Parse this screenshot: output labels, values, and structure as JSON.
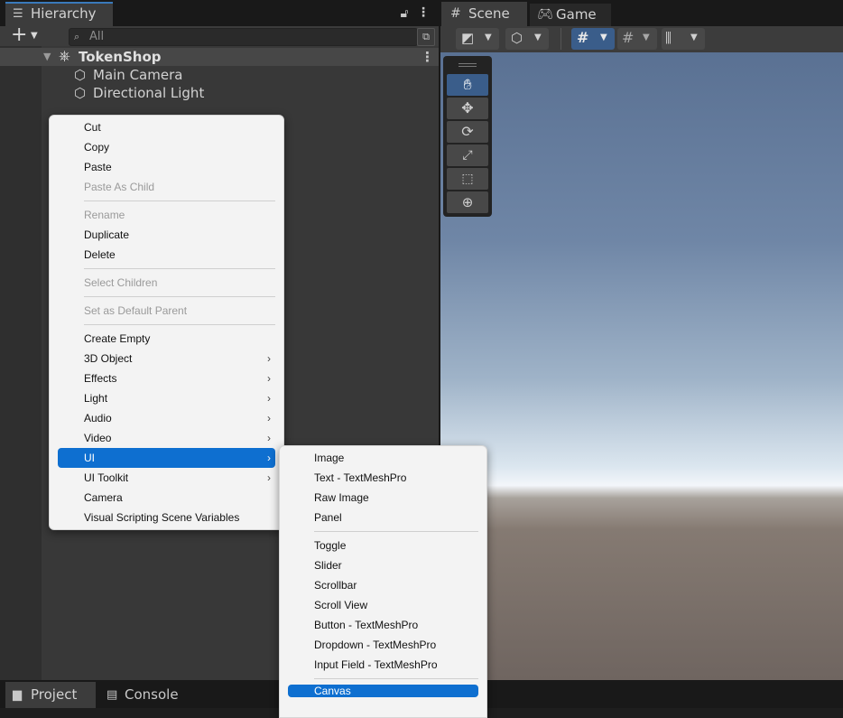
{
  "hierarchy": {
    "tab_label": "Hierarchy",
    "search_placeholder": "All",
    "scene_name": "TokenShop",
    "objects": [
      "Main Camera",
      "Directional Light"
    ]
  },
  "scene_view": {
    "tabs": [
      "Scene",
      "Game"
    ]
  },
  "context_menu": {
    "items": [
      {
        "label": "Cut",
        "enabled": true
      },
      {
        "label": "Copy",
        "enabled": true
      },
      {
        "label": "Paste",
        "enabled": true
      },
      {
        "label": "Paste As Child",
        "enabled": false
      },
      {
        "label": "Rename",
        "enabled": false
      },
      {
        "label": "Duplicate",
        "enabled": true
      },
      {
        "label": "Delete",
        "enabled": true
      },
      {
        "label": "Select Children",
        "enabled": false
      },
      {
        "label": "Set as Default Parent",
        "enabled": false
      },
      {
        "label": "Create Empty",
        "enabled": true
      },
      {
        "label": "3D Object",
        "enabled": true
      },
      {
        "label": "Effects",
        "enabled": true
      },
      {
        "label": "Light",
        "enabled": true
      },
      {
        "label": "Audio",
        "enabled": true
      },
      {
        "label": "Video",
        "enabled": true
      },
      {
        "label": "UI",
        "enabled": true
      },
      {
        "label": "UI Toolkit",
        "enabled": true
      },
      {
        "label": "Camera",
        "enabled": true
      },
      {
        "label": "Visual Scripting Scene Variables",
        "enabled": true
      }
    ]
  },
  "ui_submenu": {
    "items": [
      {
        "label": "Image"
      },
      {
        "label": "Text - TextMeshPro"
      },
      {
        "label": "Raw Image"
      },
      {
        "label": "Panel"
      },
      {
        "label": "Toggle"
      },
      {
        "label": "Slider"
      },
      {
        "label": "Scrollbar"
      },
      {
        "label": "Scroll View"
      },
      {
        "label": "Button - TextMeshPro"
      },
      {
        "label": "Dropdown - TextMeshPro"
      },
      {
        "label": "Input Field - TextMeshPro"
      },
      {
        "label": "Canvas"
      }
    ]
  },
  "bottom_tabs": [
    "Project",
    "Console"
  ],
  "colors": {
    "selection": "#0e6fd0",
    "tab_accent": "#3a79bb",
    "panel_bg": "#383838"
  }
}
